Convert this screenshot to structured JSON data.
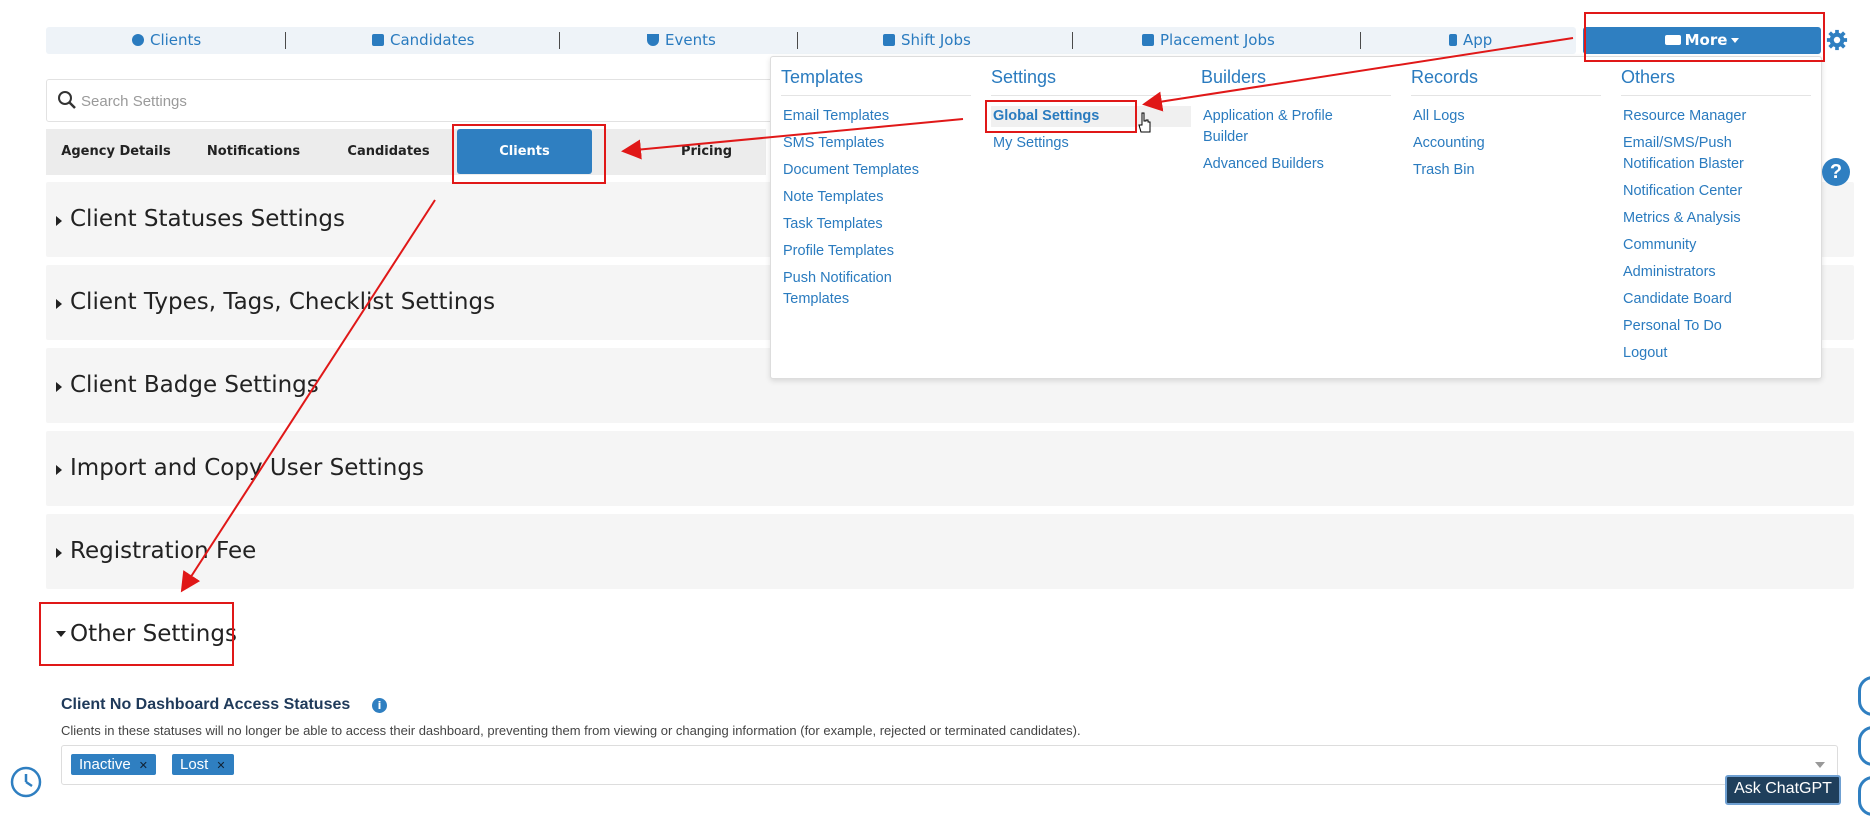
{
  "nav": {
    "items": [
      {
        "label": "Clients",
        "icon": "globe-icon"
      },
      {
        "label": "Candidates",
        "icon": "id-card-icon"
      },
      {
        "label": "Events",
        "icon": "trophy-icon"
      },
      {
        "label": "Shift Jobs",
        "icon": "calendar-icon"
      },
      {
        "label": "Placement Jobs",
        "icon": "briefcase-icon"
      },
      {
        "label": "App",
        "icon": "phone-icon"
      }
    ],
    "more_label": "More",
    "accent": "#2f7fc1"
  },
  "search": {
    "placeholder": "Search Settings"
  },
  "tabs": [
    "Agency Details",
    "Notifications",
    "Candidates",
    "Clients",
    "Pricing"
  ],
  "active_tab": "Clients",
  "sections": [
    "Client Statuses Settings",
    "Client Types, Tags, Checklist Settings",
    "Client Badge Settings",
    "Import and Copy User Settings",
    "Registration Fee",
    "Other Settings"
  ],
  "other_settings": {
    "label": "Client No Dashboard Access Statuses",
    "description": "Clients in these statuses will no longer be able to access their dashboard, preventing them from viewing or changing information (for example, rejected or terminated candidates).",
    "tags": [
      "Inactive",
      "Lost"
    ]
  },
  "menu": {
    "columns": [
      {
        "title": "Templates",
        "items": [
          "Email Templates",
          "SMS Templates",
          "Document Templates",
          "Note Templates",
          "Task Templates",
          "Profile Templates",
          "Push Notification Templates"
        ]
      },
      {
        "title": "Settings",
        "items": [
          "Global Settings",
          "My Settings"
        ]
      },
      {
        "title": "Builders",
        "items": [
          "Application & Profile Builder",
          "Advanced Builders"
        ]
      },
      {
        "title": "Records",
        "items": [
          "All Logs",
          "Accounting",
          "Trash Bin"
        ]
      },
      {
        "title": "Others",
        "items": [
          "Resource Manager",
          "Email/SMS/Push Notification Blaster",
          "Notification Center",
          "Metrics & Analysis",
          "Community",
          "Administrators",
          "Candidate Board",
          "Personal To Do",
          "Logout"
        ]
      }
    ]
  },
  "help_label": "?",
  "ask_chatgpt": "Ask ChatGPT",
  "annotation_color": "#e01818"
}
